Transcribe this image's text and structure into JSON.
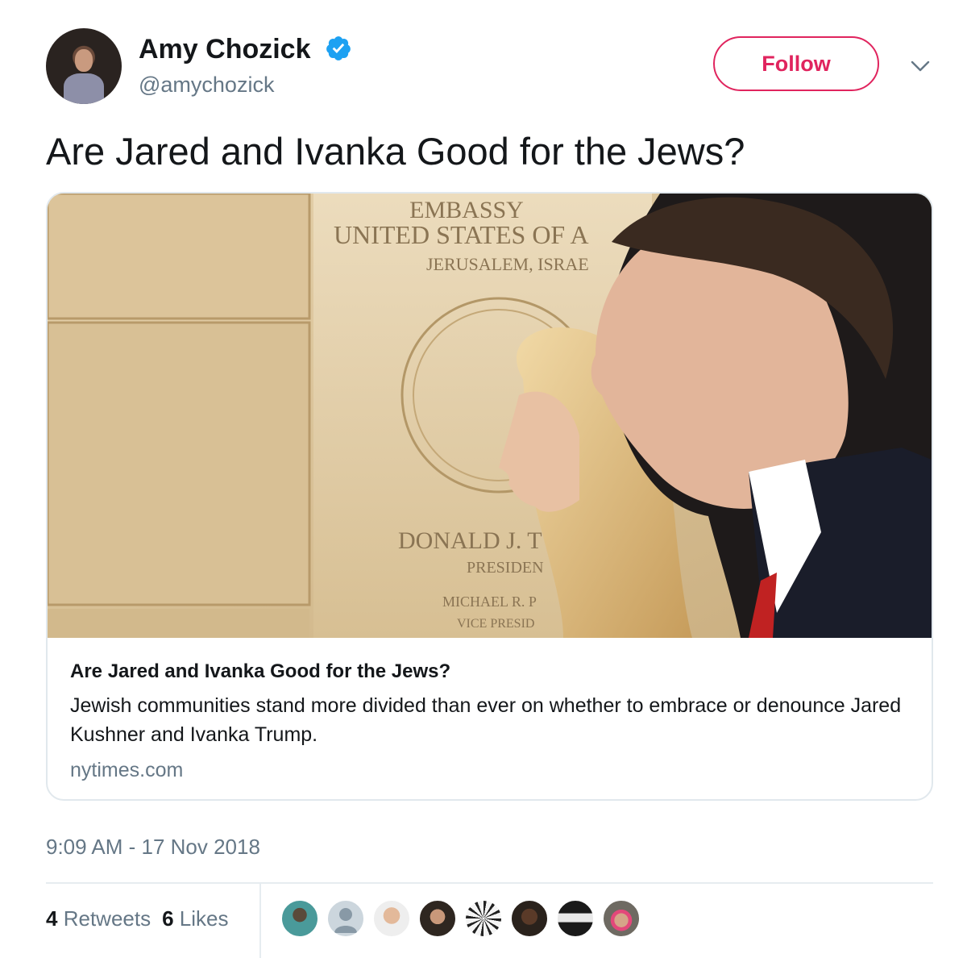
{
  "author": {
    "name": "Amy Chozick",
    "handle": "@amychozick",
    "verified": true,
    "avatar_icon": "profile-photo"
  },
  "follow_button": {
    "label": "Follow"
  },
  "menu_icon": "chevron-down-icon",
  "tweet": {
    "text": "Are Jared and Ivanka Good for the Jews?"
  },
  "card": {
    "image_caption_lines": [
      "EMBASSY",
      "UNITED STATES OF A",
      "JERUSALEM, ISRAE",
      "DONALD J. T",
      "PRESIDEN",
      "MICHAEL R. P",
      "VICE PRESID"
    ],
    "title": "Are Jared and Ivanka Good for the Jews?",
    "description": "Jewish communities stand more divided than ever on whether to embrace or denounce Jared Kushner and Ivanka Trump.",
    "domain": "nytimes.com"
  },
  "timestamp": "9:09 AM - 17 Nov 2018",
  "stats": {
    "retweets_count": "4",
    "retweets_label": "Retweets",
    "likes_count": "6",
    "likes_label": "Likes"
  },
  "likers_count_shown": 8,
  "colors": {
    "follow": "#e0245e",
    "verified": "#1da1f2",
    "secondary_text": "#657786",
    "border": "#e1e8ed"
  }
}
